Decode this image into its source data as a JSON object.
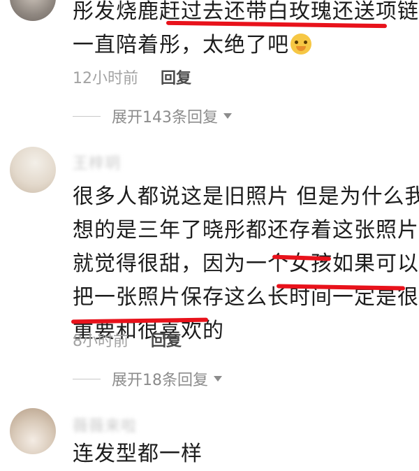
{
  "comments": [
    {
      "lines": [
        "彤发烧鹿赶过去还带白玫瑰还送项链",
        "一直陪着彤，太绝了吧"
      ],
      "emoji": "grinning-face-emoji",
      "time": "12小时前",
      "reply_label": "回复",
      "expand_label": "展开143条回复"
    },
    {
      "username": "王梓玥",
      "lines": [
        "很多人都说这是旧照片 但是为什么我",
        "想的是三年了晓彤都还存着这张照片",
        "就觉得很甜，因为一个女孩如果可以",
        "把一张照片保存这么长时间一定是很",
        "重要和很喜欢的"
      ],
      "time": "8小时前",
      "reply_label": "回复",
      "expand_label": "展开18条回复"
    },
    {
      "username": "薇薇来啦",
      "lines": [
        "连发型都一样"
      ]
    }
  ],
  "annotation_color": "#e8121b"
}
